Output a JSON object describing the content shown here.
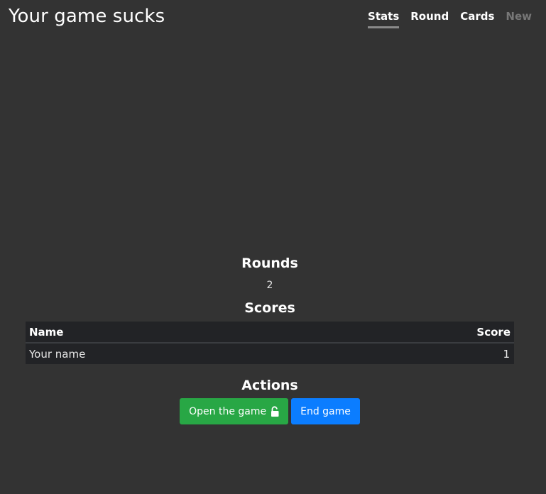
{
  "header": {
    "title": "Your game sucks",
    "tabs": [
      {
        "label": "Stats",
        "state": "active"
      },
      {
        "label": "Round",
        "state": "normal"
      },
      {
        "label": "Cards",
        "state": "normal"
      },
      {
        "label": "New",
        "state": "disabled"
      }
    ]
  },
  "rounds": {
    "heading": "Rounds",
    "value": "2"
  },
  "scores": {
    "heading": "Scores",
    "columns": [
      "Name",
      "Score"
    ],
    "rows": [
      {
        "name": "Your name",
        "score": "1"
      }
    ]
  },
  "actions": {
    "heading": "Actions",
    "open_label": "Open the game",
    "open_icon": "unlock-icon",
    "end_label": "End game"
  },
  "colors": {
    "background": "#333333",
    "open_button": "#28a745",
    "end_button": "#0b7dff"
  }
}
